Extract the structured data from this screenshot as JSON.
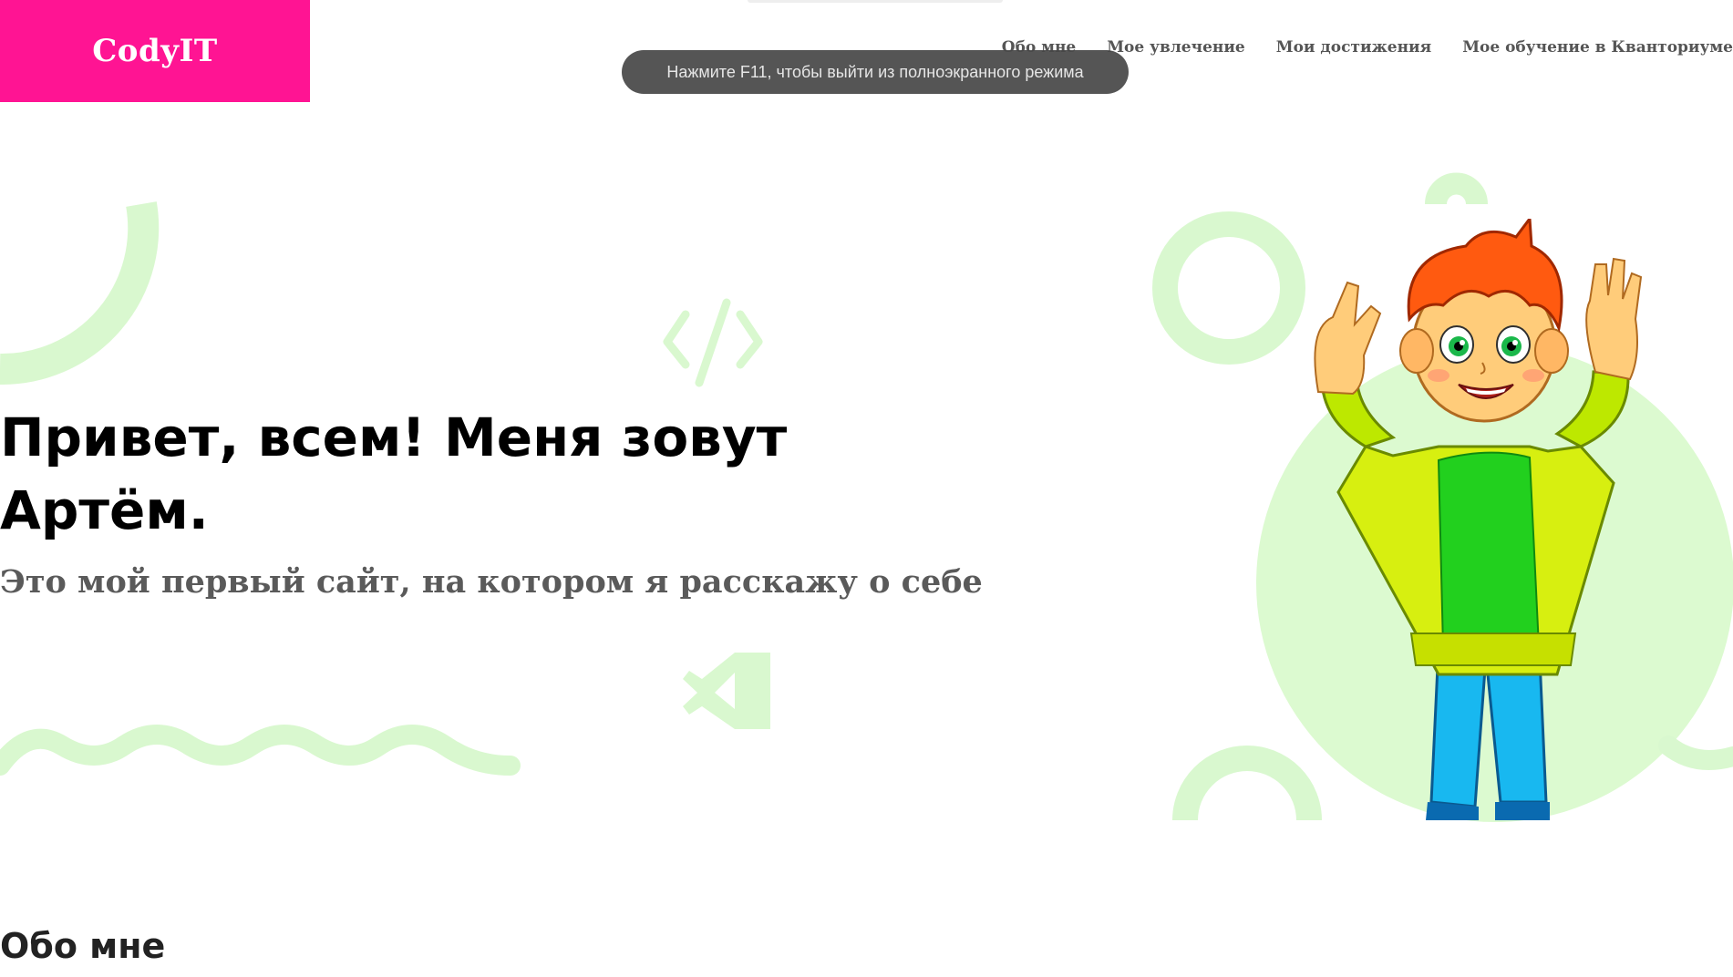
{
  "header": {
    "logo": "CodyIT",
    "nav": [
      {
        "label": "Обо мне"
      },
      {
        "label": "Мое увлечение"
      },
      {
        "label": "Мои достижения"
      },
      {
        "label": "Мое обучение в Кванториуме"
      }
    ]
  },
  "fullscreen_notice": "Нажмите F11, чтобы выйти из полноэкранного режима",
  "hero": {
    "title": "Привет, всем! Меня зовут Артём.",
    "subtitle": "Это мой первый сайт, на котором я расскажу о себе"
  },
  "about": {
    "title": "Обо мне"
  },
  "colors": {
    "brand": "#ff1493",
    "decoration": "#d9f8cf",
    "text": "#000000",
    "subtitle": "#5a5a5a"
  },
  "icons": [
    "code-brackets-icon",
    "vscode-logo-icon",
    "boy-avatar"
  ]
}
